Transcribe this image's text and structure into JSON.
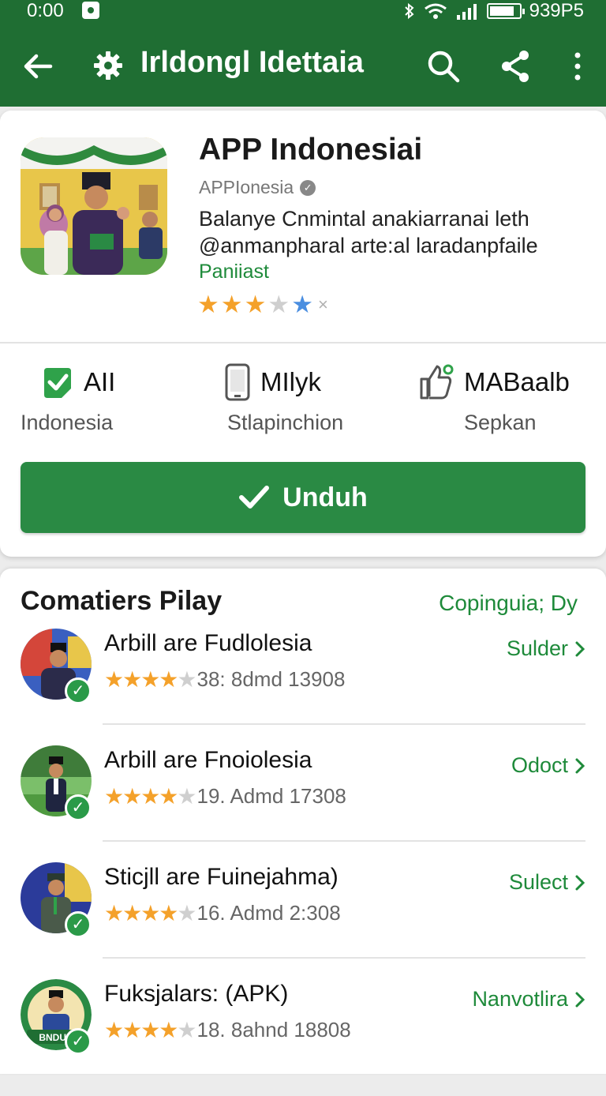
{
  "status_bar": {
    "time": "0:00",
    "right_text": "939P5"
  },
  "app_bar": {
    "title": "Irldongl Idettaia"
  },
  "app": {
    "name": "APP Indonesiai",
    "developer": "APPIonesia",
    "description": "Balanye Cnmintal anakiarranai leth @anmanpharal arte:al laradanpfaile",
    "category": "Paniiast",
    "rating_stars": 3
  },
  "stats": [
    {
      "value": "AII",
      "label": "Indonesia",
      "icon": "check-shield-icon"
    },
    {
      "value": "MIlyk",
      "label": "Stlapinchion",
      "icon": "phone-icon"
    },
    {
      "value": "MABaalb",
      "label": "Sepkan",
      "icon": "like-icon"
    }
  ],
  "install_button": {
    "label": "Unduh"
  },
  "similar": {
    "title": "Comatiers Pilay",
    "link": "Copinguia; Dy",
    "items": [
      {
        "name": "Arbill are Fudlolesia",
        "rating_stars": 4,
        "meta": "38: 8dmd 13908",
        "action": "Sulder"
      },
      {
        "name": "Arbill are Fnoiolesia",
        "rating_stars": 4,
        "meta": "19. Admd 17308",
        "action": "Odoct"
      },
      {
        "name": "Sticjll are Fuinejahma)",
        "rating_stars": 4,
        "meta": "16. Admd 2:308",
        "action": "Sulect"
      },
      {
        "name": "Fuksjalars: (APK)",
        "rating_stars": 4,
        "meta": "18. 8ahnd 18808",
        "action": "Nanvotlira",
        "avatar_text": "BNDUN"
      }
    ]
  },
  "colors": {
    "primary": "#1f6e33",
    "button": "#2a8a44",
    "accent": "#1e8a3a",
    "star": "#f4a12a"
  }
}
